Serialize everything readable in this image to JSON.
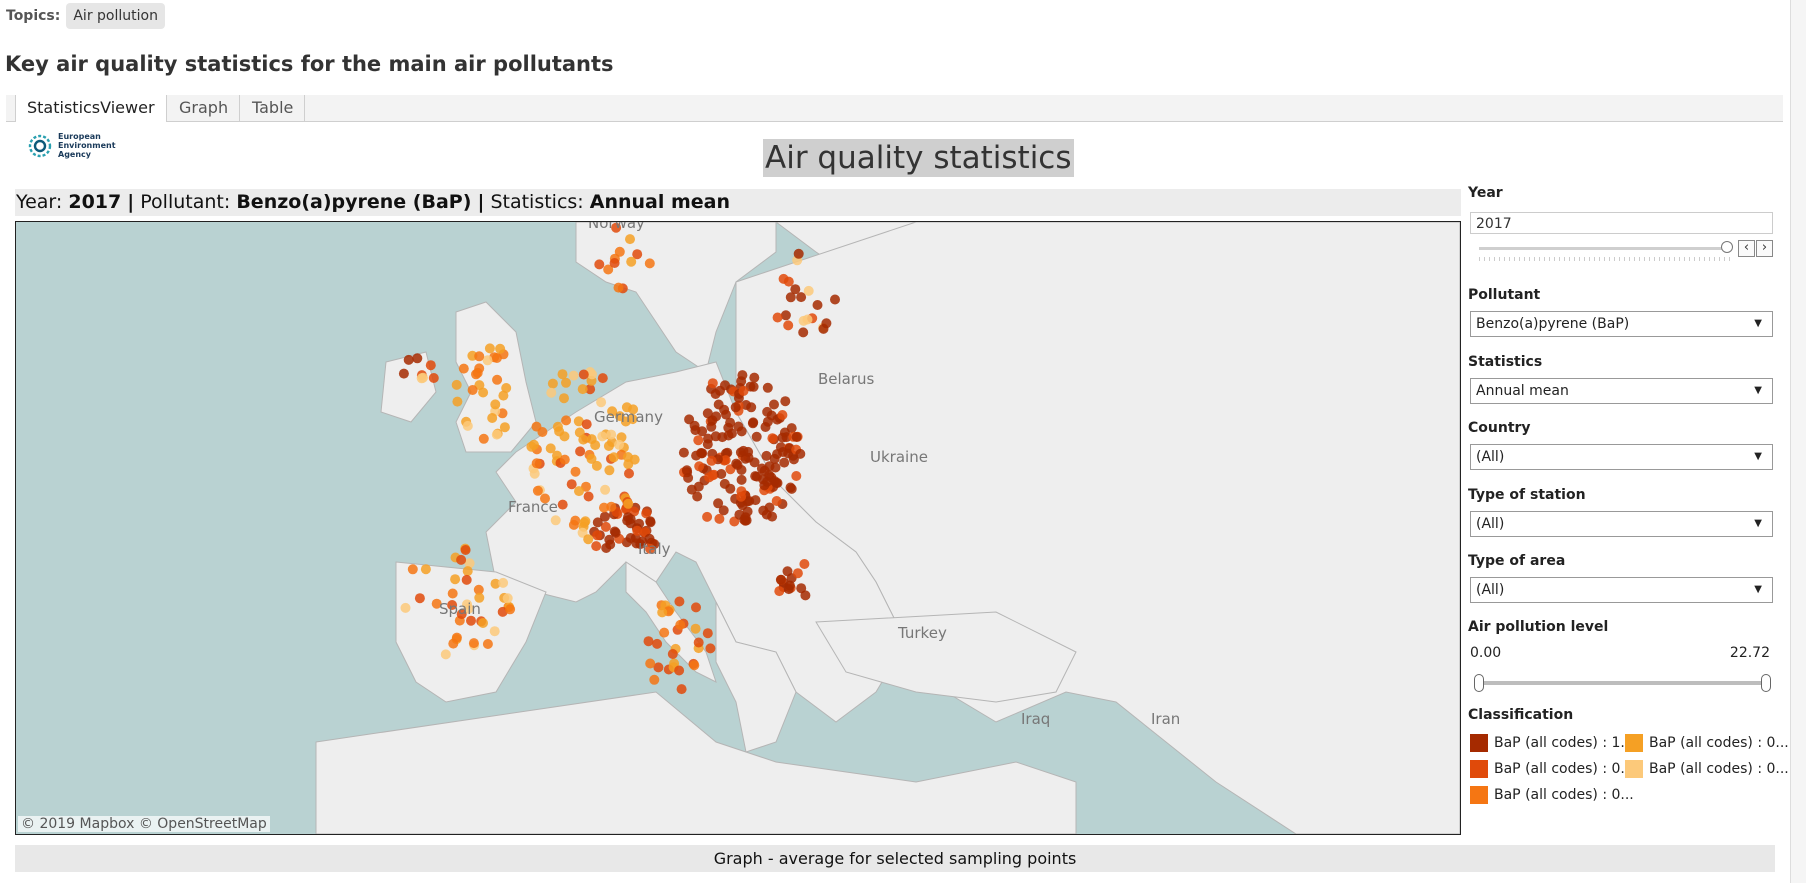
{
  "topics": {
    "label": "Topics:",
    "chip": "Air pollution"
  },
  "page_title": "Key air quality statistics for the main air pollutants",
  "tabs": [
    {
      "label": "StatisticsViewer"
    },
    {
      "label": "Graph"
    },
    {
      "label": "Table"
    }
  ],
  "logo": {
    "line1": "European",
    "line2": "Environment",
    "line3": "Agency"
  },
  "dashboard_title": "Air quality statistics",
  "subtitle": {
    "year_label": "Year:",
    "year_value": "2017",
    "pollutant_label": "Pollutant:",
    "pollutant_value": "Benzo(a)pyrene (BaP)",
    "statistics_label": "Statistics:",
    "statistics_value": "Annual mean",
    "separator": "|"
  },
  "map": {
    "credit": "© 2019 Mapbox  © OpenStreetMap",
    "labels": [
      {
        "name": "Norway"
      },
      {
        "name": "Germany"
      },
      {
        "name": "France"
      },
      {
        "name": "Spain"
      },
      {
        "name": "Italy"
      },
      {
        "name": "Belarus"
      },
      {
        "name": "Ukraine"
      },
      {
        "name": "Turkey"
      },
      {
        "name": "Iraq"
      },
      {
        "name": "Iran"
      }
    ],
    "colors": {
      "water": "#b9d2d2",
      "land": "#eeeeee",
      "border": "#b5b5b5"
    }
  },
  "controls": {
    "year": {
      "label": "Year",
      "value": "2017",
      "level": 1.0
    },
    "pollutant": {
      "label": "Pollutant",
      "value": "Benzo(a)pyrene (BaP)"
    },
    "statistics": {
      "label": "Statistics",
      "value": "Annual mean"
    },
    "country": {
      "label": "Country",
      "value": "(All)"
    },
    "station_type": {
      "label": "Type of station",
      "value": "(All)"
    },
    "area_type": {
      "label": "Type of area",
      "value": "(All)"
    },
    "pollution_level": {
      "label": "Air pollution level",
      "min": "0.00",
      "max": "22.72"
    },
    "prev_glyph": "‹",
    "next_glyph": "›",
    "dropdown_glyph": "▼"
  },
  "classification": {
    "label": "Classification",
    "items": [
      {
        "text": "BaP (all codes) : 1...",
        "color": "#a52a00"
      },
      {
        "text": "BaP (all codes) : 0...",
        "color": "#f5a024"
      },
      {
        "text": "BaP (all codes) : 0...",
        "color": "#e04a0a"
      },
      {
        "text": "BaP (all codes) : 0...",
        "color": "#fcc97a"
      },
      {
        "text": "BaP (all codes) : 0...",
        "color": "#f57613"
      }
    ]
  },
  "graph_section": {
    "title": "Graph - average for selected sampling points"
  }
}
